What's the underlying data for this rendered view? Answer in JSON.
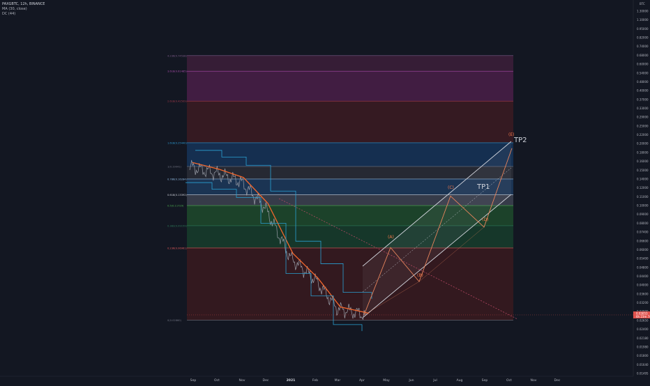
{
  "header": {
    "symbol_line": "PAXGBTC, 12h, BINANCE",
    "indicator_1": "MA (30, close)",
    "indicator_2": "DC (44)",
    "currency": "BTC"
  },
  "colors": {
    "background": "#131722",
    "price_line": "#9a9ea8",
    "ma_line": "#f2672d",
    "donchian": "#2aa1d4",
    "channel": "#d1d4dc",
    "waves": "#e7845c",
    "dotted_trend": "#c44d6a"
  },
  "price_axis": {
    "ticks": [
      "1.30000",
      "1.10000",
      "0.95000",
      "0.82000",
      "0.74000",
      "0.68000",
      "0.60000",
      "0.54000",
      "0.48000",
      "0.40000",
      "0.37000",
      "0.33000",
      "0.29000",
      "0.25000",
      "0.22000",
      "0.20000",
      "0.18000",
      "0.16000",
      "0.15000",
      "0.14000",
      "0.12000",
      "0.11000",
      "0.10000",
      "0.09000",
      "0.08000",
      "0.07400",
      "0.06600",
      "0.06000",
      "0.05400",
      "0.04800",
      "0.04400",
      "0.04000",
      "0.03600",
      "0.03200",
      "0.03000",
      "0.02650",
      "0.02400",
      "0.02180",
      "0.01980",
      "0.01800",
      "0.01640",
      "0.01495"
    ],
    "current_price": "0.03053",
    "current_price_sub": "6h 23m 7s"
  },
  "time_axis": {
    "labels": [
      "Sep",
      "Oct",
      "Nov",
      "Dec",
      "2021",
      "Feb",
      "Mar",
      "Apr",
      "May",
      "Jun",
      "Jul",
      "Aug",
      "Sep",
      "Oct",
      "Nov",
      "Dec"
    ],
    "bold_label": "2021"
  },
  "fib_levels": [
    {
      "label": "4.236(0.74538)",
      "price": 0.745,
      "color": "#7e5c8a"
    },
    {
      "label": "3.618(0.61485)",
      "price": 0.615,
      "color": "#a64ba8"
    },
    {
      "label": "2.618(0.42509)",
      "price": 0.425,
      "color": "#a2394a"
    },
    {
      "label": "1.618(0.25440)",
      "price": 0.2544,
      "color": "#2d9ed8"
    },
    {
      "label": "1(0.19041)",
      "price": 0.19,
      "color": "#6f7280"
    },
    {
      "label": "0.786(0.16284)",
      "price": 0.1628,
      "color": "#8fb8e0"
    },
    {
      "label": "0.618(0.13392)",
      "price": 0.1339,
      "color": "#d1d4dc"
    },
    {
      "label": "0.5(0.11729)",
      "price": 0.1173,
      "color": "#4caf50"
    },
    {
      "label": "0.382(0.09159)",
      "price": 0.0916,
      "color": "#2e7d5b"
    },
    {
      "label": "0.236(0.06961)",
      "price": 0.0696,
      "color": "#e05a5a"
    },
    {
      "label": "0(0.02860)",
      "price": 0.0286,
      "color": "#6f7280"
    }
  ],
  "annotations": {
    "wave_a": "(A)",
    "wave_b": "(B)",
    "wave_c": "(C)",
    "wave_d": "(D)",
    "wave_e": "(E)",
    "tp1": "TP1",
    "tp2": "TP2"
  },
  "chart_data": {
    "type": "line",
    "x": [
      "Sep 2020",
      "Oct 2020",
      "Nov 2020",
      "Dec 2020",
      "Jan 2021",
      "Feb 2021",
      "Mar 2021",
      "Apr 2021"
    ],
    "series": [
      {
        "values": [
          0.19,
          0.175,
          0.158,
          0.115,
          0.062,
          0.047,
          0.033,
          0.0305
        ]
      }
    ],
    "projection": [
      {
        "point": "(A)",
        "value": 0.07
      },
      {
        "point": "(B)",
        "value": 0.046
      },
      {
        "point": "(C)",
        "value": 0.132
      },
      {
        "point": "(D)",
        "value": 0.09
      },
      {
        "point": "(E)",
        "value": 0.238
      }
    ],
    "yscale": "log",
    "ylim": [
      0.01495,
      1.3
    ]
  }
}
